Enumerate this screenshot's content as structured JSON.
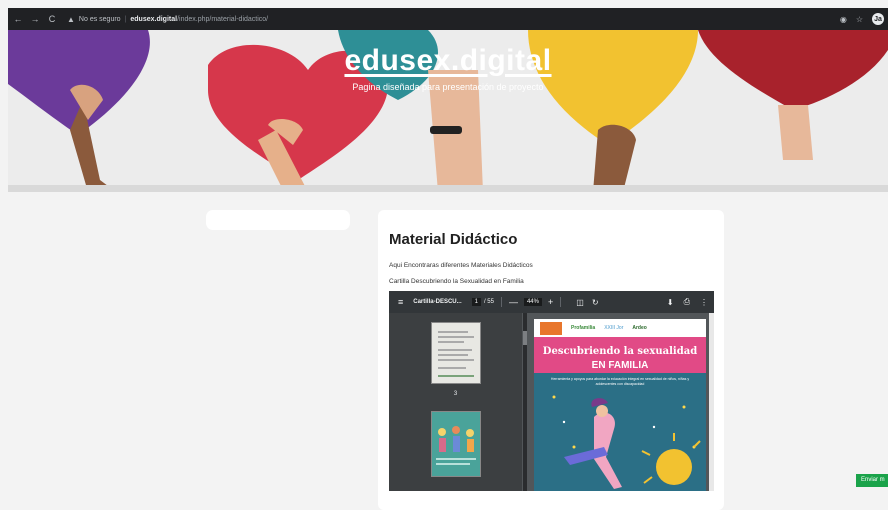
{
  "browser": {
    "back_icon": "←",
    "forward_icon": "→",
    "reload_icon": "C",
    "security_icon": "▲",
    "security_text": "No es seguro",
    "host": "edusex.digital",
    "path": "/index.php/material-didactico/",
    "avatar_initials": "Ja"
  },
  "hero": {
    "title": "edusex.digital",
    "subtitle": "Pagina diseñada para presentación de proyecto"
  },
  "content": {
    "title": "Material Didáctico",
    "intro": "Aqui Encontraras diferentes Materiales Didácticos",
    "item_label": "Cartilla Descubriendo la Sexualidad en Familia"
  },
  "pdf": {
    "menu_icon": "≡",
    "filename": "Cartilla-DESCU...",
    "current_page": "1",
    "total_pages": "/ 55",
    "zoom_out": "—",
    "zoom": "44%",
    "zoom_in": "+",
    "fit_icon": "◫",
    "rotate_icon": "↻",
    "download_icon": "⬇",
    "print_icon": "⎙",
    "more_icon": "⋮",
    "thumb_page_number": "3"
  },
  "cover": {
    "logo_profamilia": "Profamilia",
    "logo_2": "XXIII Jor",
    "logo_3": "Ardeo",
    "title_line1": "Descubriendo la sexualidad",
    "title_line2": "EN FAMILIA",
    "subtitle": "Herramienta y apoyos para abordar la educación integral en sexualidad de niños, niñas y adolescentes con discapacidad"
  },
  "send_button": "Enviar m"
}
